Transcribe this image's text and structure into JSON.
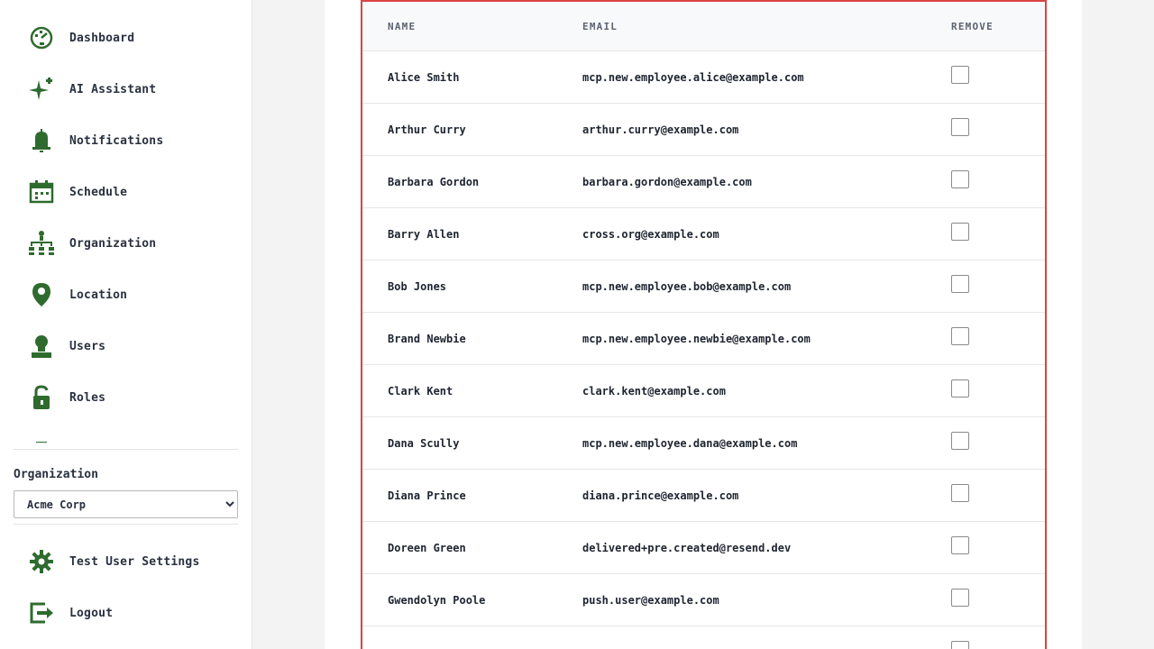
{
  "sidebar": {
    "nav": [
      {
        "label": "Dashboard",
        "icon": "dashboard-icon"
      },
      {
        "label": "AI Assistant",
        "icon": "sparkle-icon"
      },
      {
        "label": "Notifications",
        "icon": "bell-icon"
      },
      {
        "label": "Schedule",
        "icon": "calendar-icon"
      },
      {
        "label": "Organization",
        "icon": "org-chart-icon"
      },
      {
        "label": "Location",
        "icon": "map-pin-icon"
      },
      {
        "label": "Users",
        "icon": "user-icon"
      },
      {
        "label": "Roles",
        "icon": "lock-icon"
      }
    ],
    "organization_label": "Organization",
    "organization_selected": "Acme Corp",
    "footer": [
      {
        "label": "Test User Settings",
        "icon": "gear-icon"
      },
      {
        "label": "Logout",
        "icon": "logout-icon"
      }
    ]
  },
  "table": {
    "headers": {
      "name": "Name",
      "email": "Email",
      "remove": "Remove"
    },
    "rows": [
      {
        "name": "Alice Smith",
        "email": "mcp.new.employee.alice@example.com"
      },
      {
        "name": "Arthur Curry",
        "email": "arthur.curry@example.com"
      },
      {
        "name": "Barbara Gordon",
        "email": "barbara.gordon@example.com"
      },
      {
        "name": "Barry Allen",
        "email": "cross.org@example.com"
      },
      {
        "name": "Bob Jones",
        "email": "mcp.new.employee.bob@example.com"
      },
      {
        "name": "Brand Newbie",
        "email": "mcp.new.employee.newbie@example.com"
      },
      {
        "name": "Clark Kent",
        "email": "clark.kent@example.com"
      },
      {
        "name": "Dana Scully",
        "email": "mcp.new.employee.dana@example.com"
      },
      {
        "name": "Diana Prince",
        "email": "diana.prince@example.com"
      },
      {
        "name": "Doreen Green",
        "email": "delivered+pre.created@resend.dev"
      },
      {
        "name": "Gwendolyn Poole",
        "email": "push.user@example.com"
      },
      {
        "name": "",
        "email": ""
      }
    ]
  },
  "colors": {
    "icon_green": "#2f6b2f",
    "highlight_border": "#d94444"
  }
}
